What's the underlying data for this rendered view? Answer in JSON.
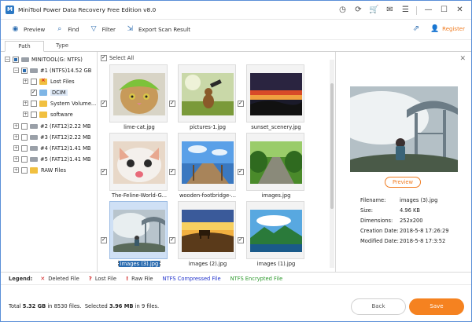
{
  "window": {
    "title": "MiniTool Power Data Recovery Free Edition v8.0"
  },
  "titlebar_icons": [
    "timer-icon",
    "refresh-icon",
    "cart-icon",
    "email-icon",
    "menu-icon",
    "minimize-icon",
    "maximize-icon",
    "close-icon"
  ],
  "toolbar": {
    "preview_label": "Preview",
    "find_label": "Find",
    "filter_label": "Filter",
    "export_label": "Export Scan Result",
    "register_label": "Register"
  },
  "tabs": [
    {
      "label": "Path"
    },
    {
      "label": "Type"
    }
  ],
  "tree": {
    "root": "MINITOOL(G: NTFS)",
    "partition1": "#1 (NTFS)14.52 GB",
    "lost_files": "Lost Files",
    "dcim": "DCIM",
    "system_volume": "System Volume...",
    "software": "software",
    "partition2": "#2 (FAT12)2.22 MB",
    "partition3": "#3 (FAT12)2.22 MB",
    "partition4": "#4 (FAT12)1.41 MB",
    "partition5": "#5 (FAT12)1.41 MB",
    "raw_files": "RAW Files"
  },
  "grid": {
    "select_all": "Select All",
    "files": [
      {
        "name": "lime-cat.jpg"
      },
      {
        "name": "pictures-1.jpg"
      },
      {
        "name": "sunset_scenery.jpg"
      },
      {
        "name": "The-Feline-World-G..."
      },
      {
        "name": "wooden-footbridge-..."
      },
      {
        "name": "images.jpg"
      },
      {
        "name": "images (3).jpg"
      },
      {
        "name": "images (2).jpg"
      },
      {
        "name": "images (1).jpg"
      }
    ]
  },
  "preview": {
    "button_label": "Preview",
    "filename_key": "Filename:",
    "filename": "images (3).jpg",
    "size_key": "Size:",
    "size": "4.96 KB",
    "dimensions_key": "Dimensions:",
    "dimensions": "252x200",
    "creation_key": "Creation Date:",
    "creation": "2018-5-8 17:26:29",
    "modified_key": "Modified Date:",
    "modified": "2018-5-8 17:3:52"
  },
  "legend": {
    "label": "Legend:",
    "deleted": "Deleted File",
    "lost": "Lost File",
    "raw": "Raw File",
    "compressed": "NTFS Compressed File",
    "encrypted": "NTFS Encrypted File"
  },
  "footer": {
    "total_prefix": "Total",
    "total_size": "5.32 GB",
    "in_word": "in",
    "total_files": "8530",
    "files_word": "files.",
    "selected_prefix": "Selected",
    "selected_size": "3.96 MB",
    "selected_count": "9",
    "back_label": "Back",
    "save_label": "Save"
  },
  "colors": {
    "accent": "#f58220",
    "blue": "#2b6cb0",
    "compressed": "#2233cc",
    "encrypted": "#2e9a2e",
    "deleted": "#d22222"
  }
}
